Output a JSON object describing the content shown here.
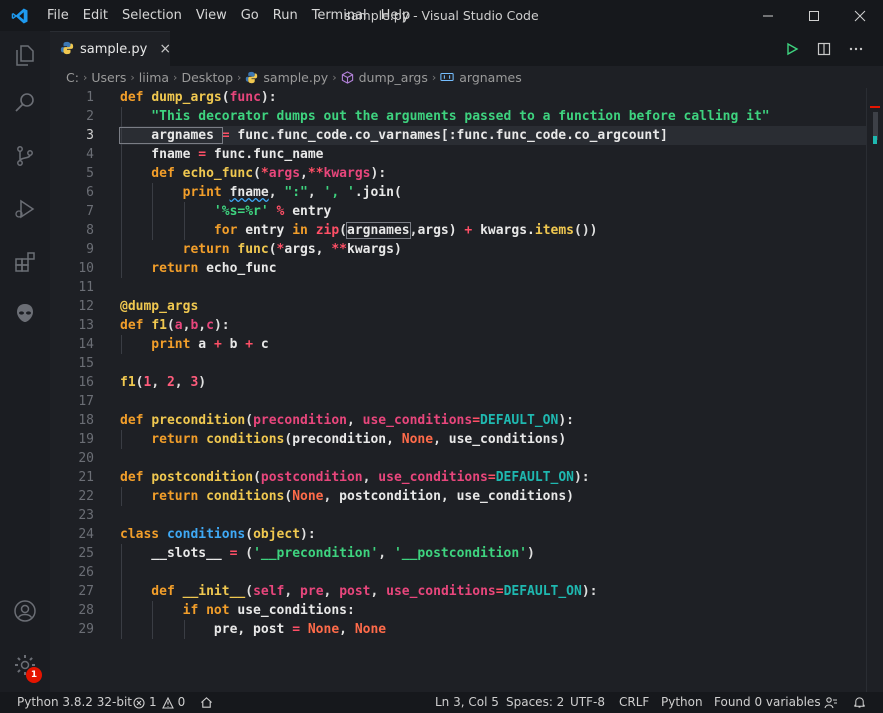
{
  "menu": [
    "File",
    "Edit",
    "Selection",
    "View",
    "Go",
    "Run",
    "Terminal",
    "Help"
  ],
  "window_title": "sample.py - Visual Studio Code",
  "tab": {
    "label": "sample.py",
    "close": "×"
  },
  "breadcrumb": [
    "C:",
    "Users",
    "liima",
    "Desktop",
    "sample.py",
    "dump_args",
    "argnames"
  ],
  "line_numbers": [
    "1",
    "2",
    "3",
    "4",
    "5",
    "6",
    "7",
    "8",
    "9",
    "10",
    "11",
    "12",
    "13",
    "14",
    "15",
    "16",
    "17",
    "18",
    "19",
    "20",
    "21",
    "22",
    "23",
    "24",
    "25",
    "26",
    "27",
    "28",
    "29"
  ],
  "activity_badge": "1",
  "status": {
    "interpreter": "Python 3.8.2 32-bit",
    "errors": "1",
    "warnings": "0",
    "position": "Ln 3, Col 5",
    "spaces": "Spaces: 2",
    "encoding": "UTF-8",
    "eol": "CRLF",
    "language": "Python",
    "find": "Found 0 variables"
  },
  "code": [
    [
      [
        "kw",
        "def "
      ],
      [
        "fn",
        "dump_args"
      ],
      [
        "par",
        "("
      ],
      [
        "prm",
        "func"
      ],
      [
        "par",
        "):"
      ]
    ],
    [
      [
        "str",
        "    \"This decorator dumps out the arguments passed to a function before calling it\""
      ]
    ],
    [
      [
        "id",
        "    argnames "
      ],
      [
        "op",
        "="
      ],
      [
        "id",
        " func.func_code.co_varnames[:func.func_code.co_argcount]"
      ]
    ],
    [
      [
        "id",
        "    fname "
      ],
      [
        "op",
        "="
      ],
      [
        "id",
        " func.func_name"
      ]
    ],
    [
      [
        "kw",
        "    def "
      ],
      [
        "fn",
        "echo_func"
      ],
      [
        "par",
        "("
      ],
      [
        "op",
        "*"
      ],
      [
        "prm",
        "args"
      ],
      [
        "par",
        ","
      ],
      [
        "op",
        "**"
      ],
      [
        "prm",
        "kwargs"
      ],
      [
        "par",
        "):"
      ]
    ],
    [
      [
        "kw",
        "        print "
      ],
      [
        "id",
        "fname"
      ],
      [
        "par",
        ", "
      ],
      [
        "str",
        "\":\""
      ],
      [
        "par",
        ", "
      ],
      [
        "str",
        "', '"
      ],
      [
        "id",
        ".join("
      ]
    ],
    [
      [
        "str",
        "            '%s=%r'"
      ],
      [
        "op",
        " % "
      ],
      [
        "id",
        "entry"
      ]
    ],
    [
      [
        "kw",
        "            for "
      ],
      [
        "id",
        "entry "
      ],
      [
        "kw",
        "in "
      ],
      [
        "op",
        "zip"
      ],
      [
        "par",
        "("
      ],
      [
        "id",
        "argnames"
      ],
      [
        "par",
        ","
      ],
      [
        "id",
        "args) "
      ],
      [
        "op",
        "+"
      ],
      [
        "id",
        " kwargs."
      ],
      [
        "fn",
        "items"
      ],
      [
        "par",
        "())"
      ]
    ],
    [
      [
        "kw",
        "        return "
      ],
      [
        "fn",
        "func"
      ],
      [
        "par",
        "("
      ],
      [
        "op",
        "*"
      ],
      [
        "id",
        "args, "
      ],
      [
        "op",
        "**"
      ],
      [
        "id",
        "kwargs)"
      ]
    ],
    [
      [
        "kw",
        "    return "
      ],
      [
        "id",
        "echo_func"
      ]
    ],
    [],
    [
      [
        "dec",
        "@dump_args"
      ]
    ],
    [
      [
        "kw",
        "def "
      ],
      [
        "fn",
        "f1"
      ],
      [
        "par",
        "("
      ],
      [
        "prm",
        "a"
      ],
      [
        "par",
        ","
      ],
      [
        "prm",
        "b"
      ],
      [
        "par",
        ","
      ],
      [
        "prm",
        "c"
      ],
      [
        "par",
        "):"
      ]
    ],
    [
      [
        "kw",
        "    print "
      ],
      [
        "id",
        "a "
      ],
      [
        "op",
        "+"
      ],
      [
        "id",
        " b "
      ],
      [
        "op",
        "+"
      ],
      [
        "id",
        " c"
      ]
    ],
    [],
    [
      [
        "fn",
        "f1"
      ],
      [
        "par",
        "("
      ],
      [
        "num",
        "1"
      ],
      [
        "par",
        ", "
      ],
      [
        "num",
        "2"
      ],
      [
        "par",
        ", "
      ],
      [
        "num",
        "3"
      ],
      [
        "par",
        ")"
      ]
    ],
    [],
    [
      [
        "kw",
        "def "
      ],
      [
        "fn",
        "precondition"
      ],
      [
        "par",
        "("
      ],
      [
        "prm",
        "precondition"
      ],
      [
        "par",
        ", "
      ],
      [
        "prm",
        "use_conditions"
      ],
      [
        "op",
        "="
      ],
      [
        "cst",
        "DEFAULT_ON"
      ],
      [
        "par",
        "):"
      ]
    ],
    [
      [
        "kw",
        "    return "
      ],
      [
        "fn",
        "conditions"
      ],
      [
        "par",
        "("
      ],
      [
        "id",
        "precondition, "
      ],
      [
        "none",
        "None"
      ],
      [
        "par",
        ", "
      ],
      [
        "id",
        "use_conditions)"
      ]
    ],
    [],
    [
      [
        "kw",
        "def "
      ],
      [
        "fn",
        "postcondition"
      ],
      [
        "par",
        "("
      ],
      [
        "prm",
        "postcondition"
      ],
      [
        "par",
        ", "
      ],
      [
        "prm",
        "use_conditions"
      ],
      [
        "op",
        "="
      ],
      [
        "cst",
        "DEFAULT_ON"
      ],
      [
        "par",
        "):"
      ]
    ],
    [
      [
        "kw",
        "    return "
      ],
      [
        "fn",
        "conditions"
      ],
      [
        "par",
        "("
      ],
      [
        "none",
        "None"
      ],
      [
        "par",
        ", "
      ],
      [
        "id",
        "postcondition, use_conditions)"
      ]
    ],
    [],
    [
      [
        "kw",
        "class "
      ],
      [
        "cls",
        "conditions"
      ],
      [
        "par",
        "("
      ],
      [
        "fn",
        "object"
      ],
      [
        "par",
        "):"
      ]
    ],
    [
      [
        "id",
        "    __slots__ "
      ],
      [
        "op",
        "="
      ],
      [
        "par",
        " ("
      ],
      [
        "str",
        "'__precondition'"
      ],
      [
        "par",
        ", "
      ],
      [
        "str",
        "'__postcondition'"
      ],
      [
        "par",
        ")"
      ]
    ],
    [],
    [
      [
        "kw",
        "    def "
      ],
      [
        "fn",
        "__init__"
      ],
      [
        "par",
        "("
      ],
      [
        "prm",
        "self"
      ],
      [
        "par",
        ", "
      ],
      [
        "prm",
        "pre"
      ],
      [
        "par",
        ", "
      ],
      [
        "prm",
        "post"
      ],
      [
        "par",
        ", "
      ],
      [
        "prm",
        "use_conditions"
      ],
      [
        "op",
        "="
      ],
      [
        "cst",
        "DEFAULT_ON"
      ],
      [
        "par",
        "):"
      ]
    ],
    [
      [
        "kw",
        "        if not "
      ],
      [
        "id",
        "use_conditions"
      ],
      [
        "par",
        ":"
      ]
    ],
    [
      [
        "id",
        "            pre, post "
      ],
      [
        "op",
        "="
      ],
      [
        "none",
        " None"
      ],
      [
        "par",
        ", "
      ],
      [
        "none",
        "None"
      ]
    ]
  ]
}
